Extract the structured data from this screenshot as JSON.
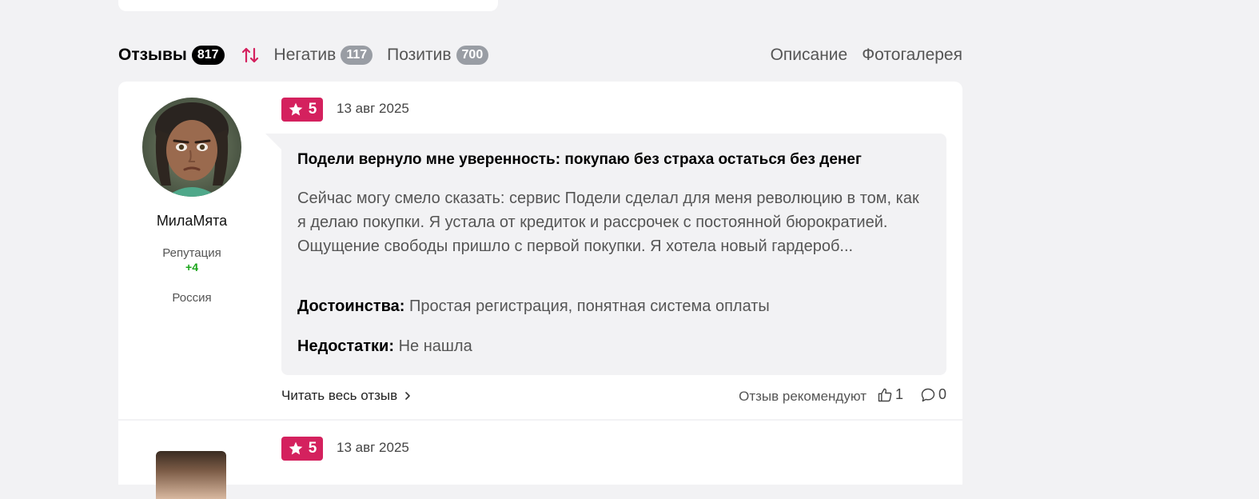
{
  "tabs": {
    "reviews_label": "Отзывы",
    "reviews_count": "817",
    "negative_label": "Негатив",
    "negative_count": "117",
    "positive_label": "Позитив",
    "positive_count": "700",
    "description_label": "Описание",
    "gallery_label": "Фотогалерея"
  },
  "colors": {
    "accent": "#d4215e",
    "reputation_positive": "#1aa51a"
  },
  "reviews": [
    {
      "author": "МилаМята",
      "reputation_label": "Репутация",
      "reputation_value": "+4",
      "country": "Россия",
      "rating": "5",
      "date": "13 авг 2025",
      "title": "Подели вернуло мне уверенность: покупаю без страха остаться без денег",
      "body": "Сейчас могу смело сказать: сервис Подели сделал для меня революцию в том, как я делаю покупки. Я устала от кредиток и рассрочек с постоянной бюрократией. Ощущение свободы пришло с первой покупки. Я хотела новый гардероб...",
      "pros_label": "Достоинства:",
      "pros": "Простая регистрация, понятная система оплаты",
      "cons_label": "Недостатки:",
      "cons": "Не нашла",
      "read_more": "Читать весь отзыв",
      "recommend_label": "Отзыв рекомендуют",
      "likes": "1",
      "comments": "0"
    },
    {
      "rating": "5",
      "date": "13 авг 2025"
    }
  ],
  "icons": {
    "sort": "sort-arrows-icon",
    "star": "star-icon",
    "chevron": "chevron-right-icon",
    "like": "thumbs-up-icon",
    "comment": "comment-bubble-icon"
  }
}
